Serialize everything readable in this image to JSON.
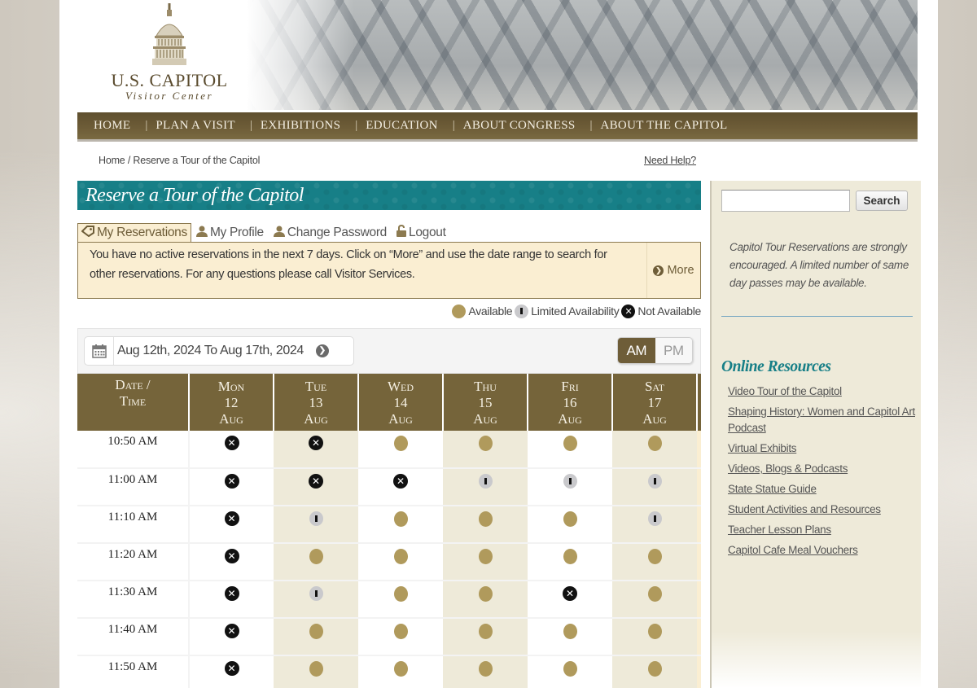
{
  "logo": {
    "title": "U.S. CAPITOL",
    "subtitle": "Visitor Center"
  },
  "nav": {
    "items": [
      {
        "label": "HOME"
      },
      {
        "label": "PLAN A VISIT"
      },
      {
        "label": "EXHIBITIONS"
      },
      {
        "label": "EDUCATION"
      },
      {
        "label": "ABOUT CONGRESS"
      },
      {
        "label": "ABOUT THE CAPITOL"
      }
    ]
  },
  "breadcrumb": "Home / Reserve a Tour of the Capitol",
  "need_help": "Need Help?",
  "page_title": "Reserve a Tour of the Capitol",
  "tabs": [
    {
      "label": "My Reservations",
      "icon": "ticket-icon",
      "active": true
    },
    {
      "label": "My Profile",
      "icon": "user-icon",
      "active": false
    },
    {
      "label": "Change Password",
      "icon": "user-icon",
      "active": false
    },
    {
      "label": "Logout",
      "icon": "unlock-icon",
      "active": false
    }
  ],
  "info": {
    "message": "You have no active reservations in the next 7 days. Click on “More” and use the date range to search for other reservations. For any questions please call Visitor Services.",
    "more_label": "More"
  },
  "legend": {
    "available": "Available",
    "limited": "Limited Availability",
    "unavailable": "Not Available"
  },
  "date_range": {
    "label": "Aug 12th, 2024 To Aug 17th, 2024"
  },
  "period_toggle": {
    "am": "AM",
    "pm": "PM",
    "selected": "AM"
  },
  "schedule": {
    "time_header_1": "Date /",
    "time_header_2": "Time",
    "days": [
      {
        "dow": "Mon",
        "day": "12",
        "month": "Aug"
      },
      {
        "dow": "Tue",
        "day": "13",
        "month": "Aug"
      },
      {
        "dow": "Wed",
        "day": "14",
        "month": "Aug"
      },
      {
        "dow": "Thu",
        "day": "15",
        "month": "Aug"
      },
      {
        "dow": "Fri",
        "day": "16",
        "month": "Aug"
      },
      {
        "dow": "Sat",
        "day": "17",
        "month": "Aug"
      }
    ],
    "rows": [
      {
        "time": "10:50 AM",
        "slots": [
          "unavailable",
          "unavailable",
          "available",
          "available",
          "available",
          "available"
        ]
      },
      {
        "time": "11:00 AM",
        "slots": [
          "unavailable",
          "unavailable",
          "unavailable",
          "limited",
          "limited",
          "limited"
        ]
      },
      {
        "time": "11:10 AM",
        "slots": [
          "unavailable",
          "limited",
          "available",
          "available",
          "available",
          "limited"
        ]
      },
      {
        "time": "11:20 AM",
        "slots": [
          "unavailable",
          "available",
          "available",
          "available",
          "available",
          "available"
        ]
      },
      {
        "time": "11:30 AM",
        "slots": [
          "unavailable",
          "limited",
          "available",
          "available",
          "unavailable",
          "available"
        ]
      },
      {
        "time": "11:40 AM",
        "slots": [
          "unavailable",
          "available",
          "available",
          "available",
          "available",
          "available"
        ]
      },
      {
        "time": "11:50 AM",
        "slots": [
          "unavailable",
          "available",
          "available",
          "available",
          "available",
          "available"
        ]
      }
    ]
  },
  "sidebar": {
    "search_placeholder": "",
    "search_button": "Search",
    "notice": "Capitol Tour Reservations are strongly encouraged. A limited number of same day passes may be available.",
    "resources_title": "Online Resources",
    "resources": [
      {
        "label": "Video Tour of the Capitol"
      },
      {
        "label": "Shaping History: Women and Capitol Art Podcast"
      },
      {
        "label": "Virtual Exhibits"
      },
      {
        "label": "Videos, Blogs & Podcasts"
      },
      {
        "label": "State Statue Guide"
      },
      {
        "label": "Student Activities and Resources"
      },
      {
        "label": "Teacher Lesson Plans"
      },
      {
        "label": "Capitol Cafe Meal Vouchers"
      }
    ]
  },
  "colors": {
    "brand_brown": "#75643a",
    "teal": "#177f87",
    "available": "#b09a5c",
    "limited": "#c9c9cc",
    "unavailable": "#111111",
    "info_bg": "#faeed2",
    "sidebar_bg": "#eeead9"
  }
}
